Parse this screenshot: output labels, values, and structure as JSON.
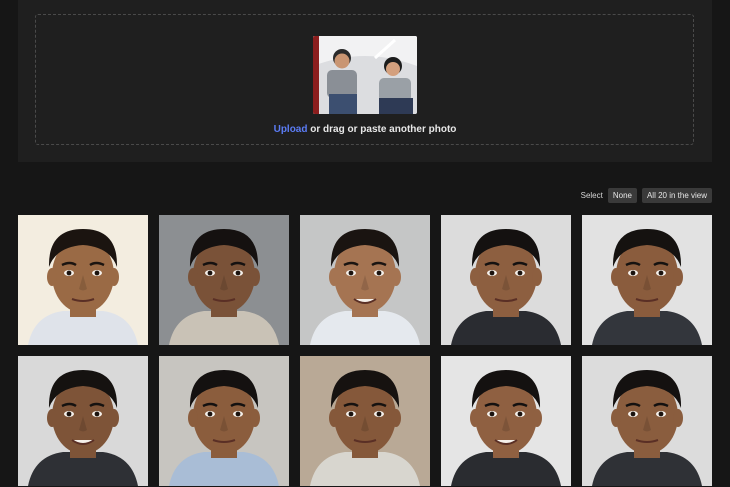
{
  "upload": {
    "link_label": "Upload",
    "rest_text": " or drag or paste another photo"
  },
  "select": {
    "label": "Select",
    "none_button": "None",
    "all_button": "All 20 in the view"
  },
  "faces": [
    {
      "bg": "#f3ede0",
      "skin": "#9a6a45",
      "hair": "#1b1410",
      "shirt": "#dfe3ea"
    },
    {
      "bg": "#8c8f92",
      "skin": "#7a5238",
      "hair": "#151110",
      "shirt": "#c9c2b6"
    },
    {
      "bg": "#c5c6c6",
      "skin": "#a57452",
      "hair": "#1a1411",
      "shirt": "#e5e9ee"
    },
    {
      "bg": "#dcdcdc",
      "skin": "#8d5f40",
      "hair": "#141110",
      "shirt": "#2a2c31"
    },
    {
      "bg": "#e2e2e2",
      "skin": "#8a5c3d",
      "hair": "#151210",
      "shirt": "#33363c"
    },
    {
      "bg": "#d9d9d9",
      "skin": "#7e5438",
      "hair": "#151210",
      "shirt": "#2e3035"
    },
    {
      "bg": "#c7c5c0",
      "skin": "#8b5d3d",
      "hair": "#141110",
      "shirt": "#a9bdd6"
    },
    {
      "bg": "#b9a996",
      "skin": "#85583a",
      "hair": "#161210",
      "shirt": "#d8d6cf"
    },
    {
      "bg": "#e5e5e5",
      "skin": "#8f6041",
      "hair": "#141110",
      "shirt": "#2a2c30"
    },
    {
      "bg": "#dcdcdc",
      "skin": "#8a5d3e",
      "hair": "#141110",
      "shirt": "#2f3136"
    }
  ]
}
